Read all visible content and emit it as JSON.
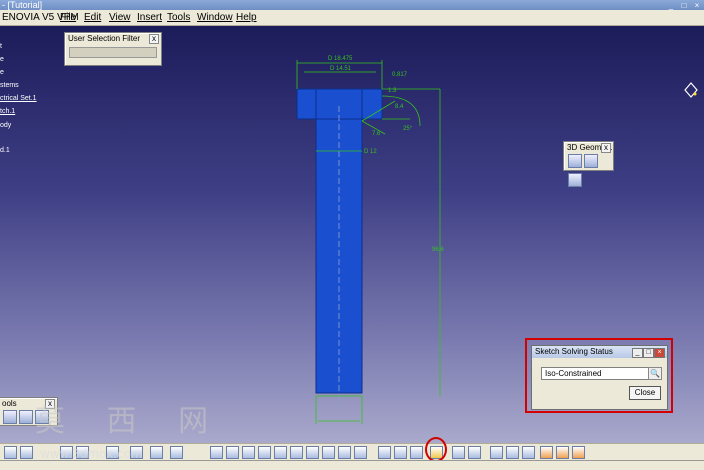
{
  "window": {
    "title": "- [Tutorial]",
    "app_name": "ENOVIA V5 VPM",
    "controls": [
      "_",
      "□",
      "×"
    ]
  },
  "menus": [
    "File",
    "Edit",
    "View",
    "Insert",
    "Tools",
    "Window",
    "Help"
  ],
  "tree": {
    "items": [
      {
        "label": "t",
        "underlined": false
      },
      {
        "label": "e",
        "underlined": false
      },
      {
        "label": "e",
        "underlined": false
      },
      {
        "label": "stems",
        "underlined": false
      },
      {
        "label": "ctrical Set.1",
        "underlined": true
      },
      {
        "label": "tch.1",
        "underlined": true
      },
      {
        "label": "ody",
        "underlined": false
      },
      {
        "label": "d.1",
        "underlined": false
      }
    ]
  },
  "user_selection_filter": {
    "title": "User Selection Filter",
    "close": "x"
  },
  "geom_toolbar": {
    "title": "3D Geome...",
    "close": "x"
  },
  "tools_toolbar": {
    "title": "ools",
    "close": "x"
  },
  "sketch_status": {
    "title": "Sketch Solving Status",
    "status": "Iso-Constrained",
    "close_label": "Close",
    "status_icon": "🔍"
  },
  "dimensions": {
    "d1": "D 18.475",
    "d2": "D 14.51",
    "d3": "0.817",
    "d4": "1.3",
    "d5": "8.4",
    "d6": "25°",
    "d7": "7.6",
    "d8": "D 12",
    "d9": "96.6"
  },
  "watermark": {
    "chars": "莫 西 网",
    "url": "www.3dmox.com"
  },
  "colors": {
    "bolt": "#1a4fd0",
    "dimension": "#35c21c",
    "highlight": "#d20000"
  }
}
